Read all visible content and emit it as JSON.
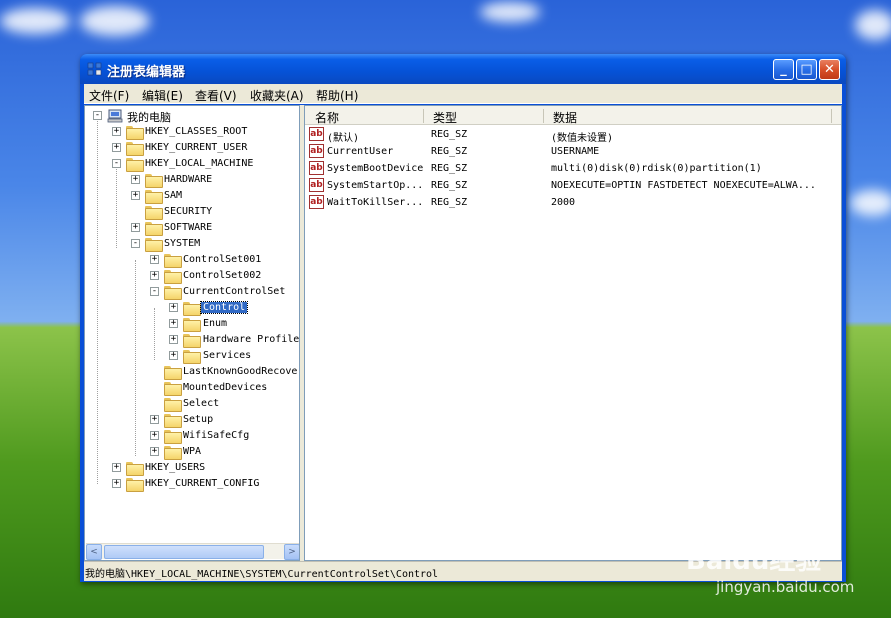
{
  "window": {
    "title": "注册表编辑器",
    "buttons": {
      "minimize": "_",
      "maximize": "□",
      "close": "✕"
    }
  },
  "menubar": [
    "文件(F)",
    "编辑(E)",
    "查看(V)",
    "收藏夹(A)",
    "帮助(H)"
  ],
  "tree": {
    "root": "我的电脑",
    "nodes": [
      {
        "label": "HKEY_CLASSES_ROOT",
        "expander": "+"
      },
      {
        "label": "HKEY_CURRENT_USER",
        "expander": "+"
      },
      {
        "label": "HKEY_LOCAL_MACHINE",
        "expander": "-"
      },
      {
        "label": "HARDWARE",
        "expander": "+"
      },
      {
        "label": "SAM",
        "expander": "+"
      },
      {
        "label": "SECURITY",
        "expander": ""
      },
      {
        "label": "SOFTWARE",
        "expander": "+"
      },
      {
        "label": "SYSTEM",
        "expander": "-"
      },
      {
        "label": "ControlSet001",
        "expander": "+"
      },
      {
        "label": "ControlSet002",
        "expander": "+"
      },
      {
        "label": "CurrentControlSet",
        "expander": "-"
      },
      {
        "label": "Control",
        "expander": "+",
        "selected": true
      },
      {
        "label": "Enum",
        "expander": "+"
      },
      {
        "label": "Hardware Profile",
        "expander": "+"
      },
      {
        "label": "Services",
        "expander": "+"
      },
      {
        "label": "LastKnownGoodRecove",
        "expander": ""
      },
      {
        "label": "MountedDevices",
        "expander": ""
      },
      {
        "label": "Select",
        "expander": ""
      },
      {
        "label": "Setup",
        "expander": "+"
      },
      {
        "label": "WifiSafeCfg",
        "expander": "+"
      },
      {
        "label": "WPA",
        "expander": "+"
      },
      {
        "label": "HKEY_USERS",
        "expander": "+"
      },
      {
        "label": "HKEY_CURRENT_CONFIG",
        "expander": "+"
      }
    ],
    "scroll": {
      "left": "<",
      "right": ">"
    }
  },
  "list": {
    "columns": [
      "名称",
      "类型",
      "数据"
    ],
    "rows": [
      {
        "icon": "ab",
        "name": "(默认)",
        "type": "REG_SZ",
        "data": "(数值未设置)"
      },
      {
        "icon": "ab",
        "name": "CurrentUser",
        "type": "REG_SZ",
        "data": "USERNAME"
      },
      {
        "icon": "ab",
        "name": "SystemBootDevice",
        "type": "REG_SZ",
        "data": "multi(0)disk(0)rdisk(0)partition(1)"
      },
      {
        "icon": "ab",
        "name": "SystemStartOp...",
        "type": "REG_SZ",
        "data": "NOEXECUTE=OPTIN  FASTDETECT  NOEXECUTE=ALWA..."
      },
      {
        "icon": "ab",
        "name": "WaitToKillSer...",
        "type": "REG_SZ",
        "data": "2000"
      }
    ]
  },
  "status": "我的电脑\\HKEY_LOCAL_MACHINE\\SYSTEM\\CurrentControlSet\\Control",
  "watermark": {
    "brand": "Baidu经验",
    "url": "jingyan.baidu.com"
  }
}
